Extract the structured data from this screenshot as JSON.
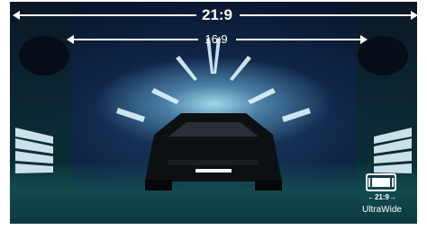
{
  "aspect_21_9": {
    "label": "21:9"
  },
  "aspect_16_9": {
    "label": "16:9"
  },
  "badge": {
    "mini_label": "21:9",
    "label": "UltraWide",
    "icon": "ultrawide-screen-icon"
  },
  "colors": {
    "text": "#ffffff",
    "tunnel_light": "#d9f3ff",
    "floor": "#134a50"
  }
}
